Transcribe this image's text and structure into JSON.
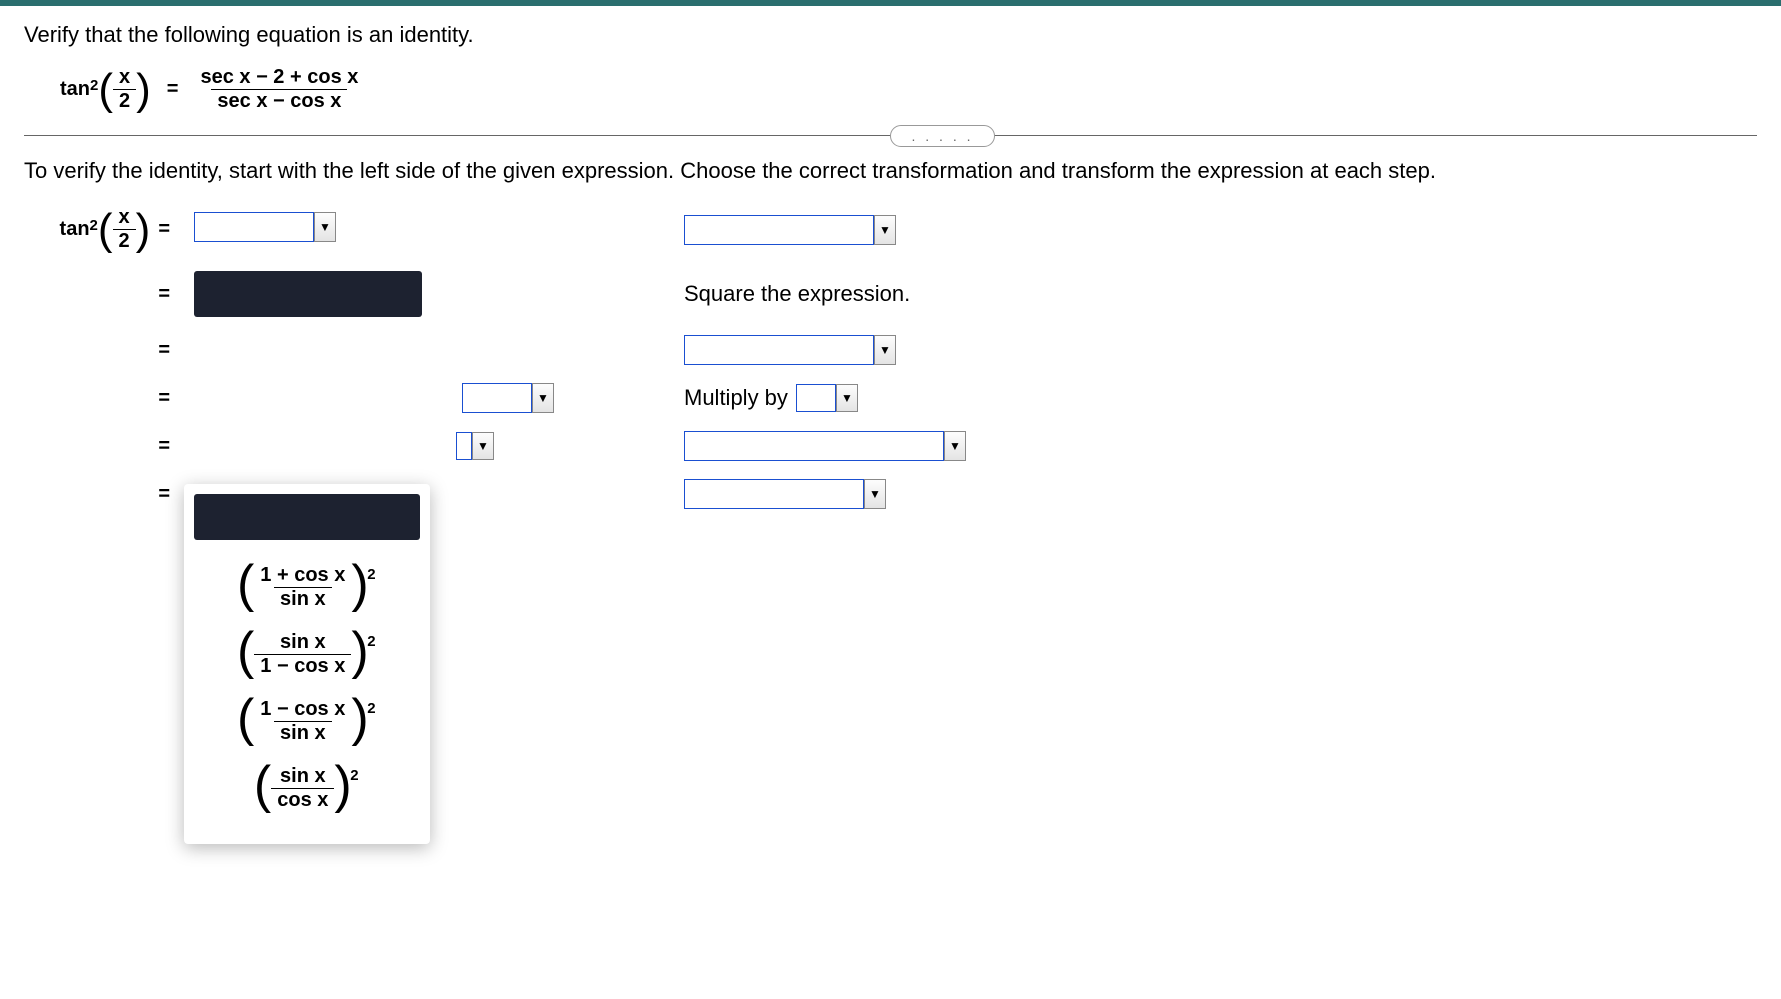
{
  "problem": {
    "instruction_top": "Verify that the following equation is an identity.",
    "lhs_func": "tan",
    "lhs_exp": "2",
    "lhs_arg_num": "x",
    "lhs_arg_den": "2",
    "equals": "=",
    "rhs_num": "sec x − 2 + cos x",
    "rhs_den": "sec x − cos x"
  },
  "divider_dots": ". . . . .",
  "instruction_main": "To verify the identity, start with the left side of the given expression. Choose the correct transformation and transform the expression at each step.",
  "steps": {
    "lhs_func": "tan",
    "lhs_exp": "2",
    "lhs_arg_num": "x",
    "lhs_arg_den": "2",
    "equals": "=",
    "square_text": "Square the expression.",
    "multiply_text": "Multiply by"
  },
  "options": {
    "opt1_num": "1 + cos x",
    "opt1_den": "sin x",
    "opt1_exp": "2",
    "opt2_num": "sin x",
    "opt2_den": "1 − cos x",
    "opt2_exp": "2",
    "opt3_num": "1 − cos x",
    "opt3_den": "sin x",
    "opt3_exp": "2",
    "opt4_num": "sin x",
    "opt4_den": "cos x",
    "opt4_exp": "2"
  }
}
